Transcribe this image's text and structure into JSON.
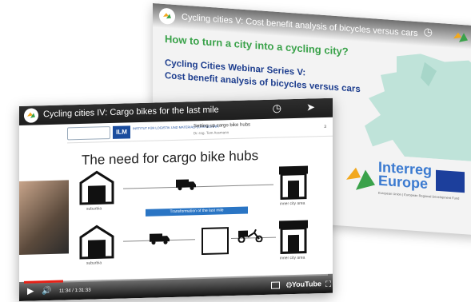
{
  "back_video": {
    "title": "Cycling cities V: Cost benefit analysis of bicycles versus cars",
    "kicker": "How to turn a city into a cycling city?",
    "series_line1": "Cycling Cities Webinar Series V:",
    "series_line2": "Cost benefit analysis of bicycles versus cars",
    "brand_line1": "Interreg",
    "brand_line2": "Europe",
    "brand_sub": "European Union | European Regional Development Fund"
  },
  "front_video": {
    "title": "Cycling cities IV: Cargo bikes for the last mile",
    "header_institute": "INSTITUT FÜR LOGISTIK UND MATERIALFLUSSTECHNIK",
    "header_ilm": "ILM",
    "slide_title": "Setting up cargo bike hubs",
    "slide_author": "Dr.-Ing. Tom Assmann",
    "slide_page": "3",
    "heading": "The need for cargo bike hubs",
    "label_suburbia_1": "suburbia",
    "label_inner_1": "inner city area",
    "transform_label": "Transformation of the last mile",
    "label_suburbia_2": "suburbia",
    "label_inner_2": "inner city area",
    "more_videos": "MORE VIDEOS",
    "time": "11:34 / 1:31:33",
    "youtube": "YouTube",
    "progress": 0.128
  }
}
